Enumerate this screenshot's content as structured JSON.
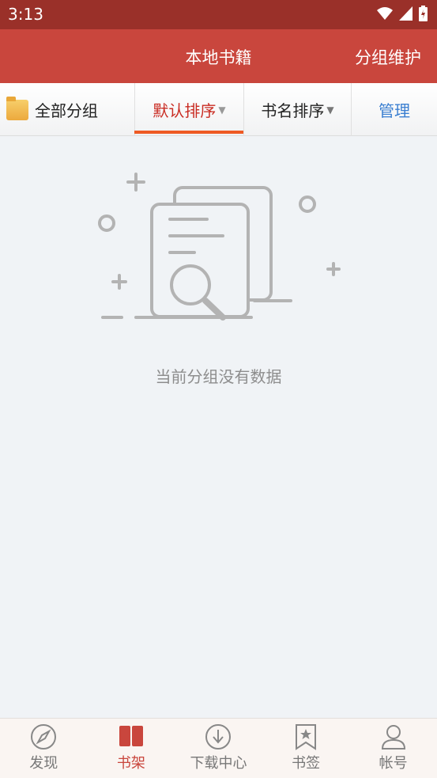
{
  "status": {
    "time": "3:13"
  },
  "appbar": {
    "title": "本地书籍",
    "action": "分组维护"
  },
  "toolbar": {
    "group_label": "全部分组",
    "sort_default": "默认排序",
    "sort_name": "书名排序",
    "manage": "管理"
  },
  "empty": {
    "message": "当前分组没有数据"
  },
  "nav": [
    {
      "label": "发现",
      "icon": "compass-icon"
    },
    {
      "label": "书架",
      "icon": "book-icon"
    },
    {
      "label": "下载中心",
      "icon": "download-icon"
    },
    {
      "label": "书签",
      "icon": "bookmark-icon"
    },
    {
      "label": "帐号",
      "icon": "user-icon"
    }
  ],
  "colors": {
    "statusbar": "#9a3029",
    "appbar": "#c9463d",
    "active": "#c9463d",
    "accent_underline": "#ee5a24",
    "manage": "#3b7fd1"
  }
}
